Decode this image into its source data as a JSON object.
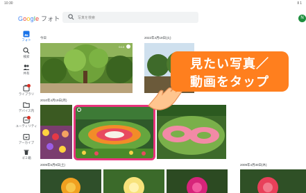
{
  "status_bar": {
    "time": "10:30",
    "right": "Ⅱ 1"
  },
  "header": {
    "logo_parts": [
      "G",
      "o",
      "o",
      "g",
      "l",
      "e"
    ],
    "logo_suffix": " フォト",
    "search_placeholder": "写真を検索",
    "avatar_initial": "N"
  },
  "sidebar": {
    "items": [
      {
        "label": "フォト",
        "icon": "photos-icon",
        "active": true
      },
      {
        "label": "検索",
        "icon": "search-icon"
      },
      {
        "label": "共有",
        "icon": "people-icon"
      },
      {
        "label": "ライブラリ",
        "icon": "library-icon",
        "badge": true
      },
      {
        "label": "デバイス内",
        "icon": "folder-icon"
      },
      {
        "label": "ユーティリティ",
        "icon": "utilities-icon",
        "badge": true
      },
      {
        "label": "アーカイブ",
        "icon": "archive-icon"
      },
      {
        "label": "ゴミ箱",
        "icon": "trash-icon"
      }
    ]
  },
  "timeline": {
    "sections": [
      {
        "date": "今日"
      },
      {
        "date": "2022年4月19日(火)"
      },
      {
        "date": "2010年4月19日(月)"
      },
      {
        "date": "2009年5月9日(土)"
      },
      {
        "date": "2009年4月30日(木)"
      }
    ],
    "first_photo_time": "0:13"
  },
  "callout": {
    "line1": "見たい写真／",
    "line2": "動画をタップ"
  },
  "colors": {
    "accent": "#1a73e8",
    "selection": "#e8337c",
    "callout": "#ff7f1e"
  }
}
